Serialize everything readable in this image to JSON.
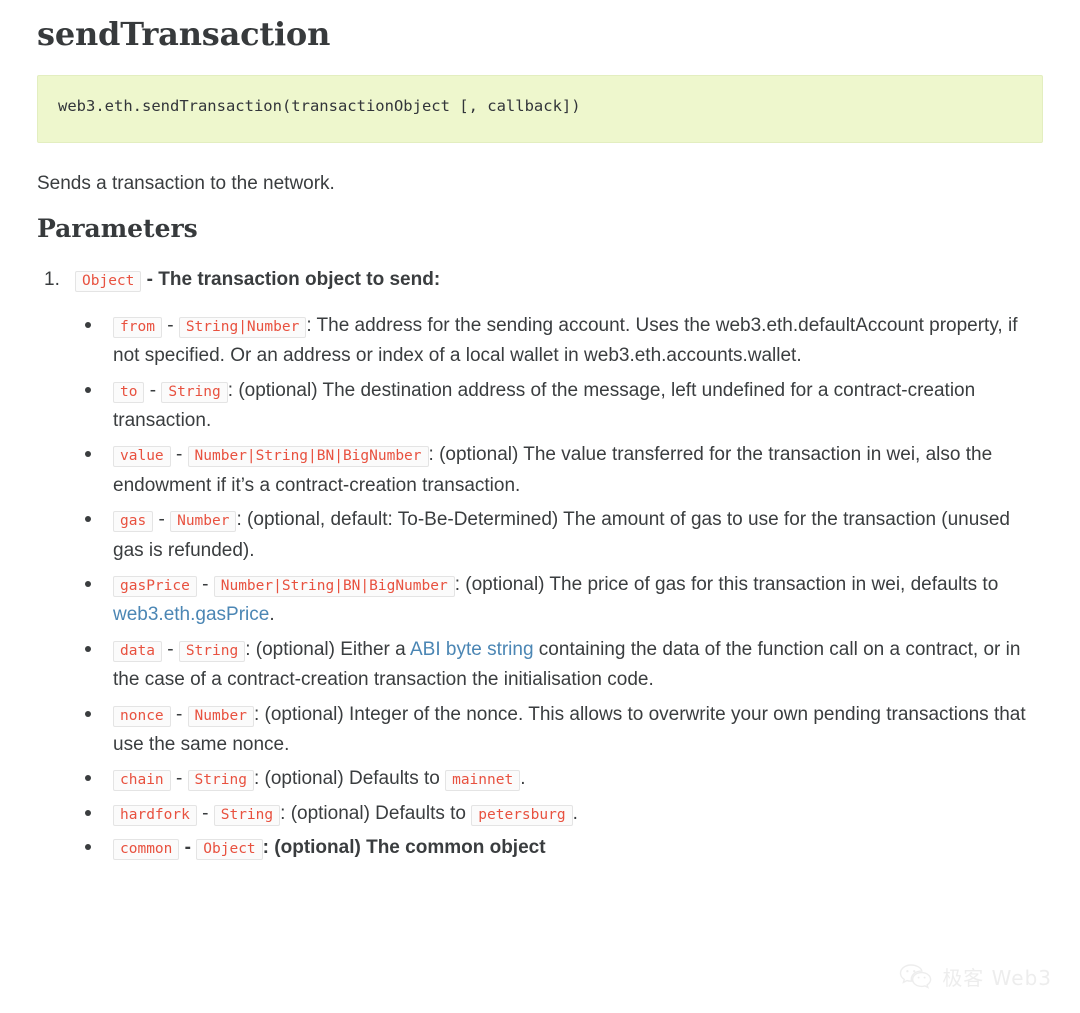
{
  "page": {
    "title": "sendTransaction",
    "signature": "web3.eth.sendTransaction(transactionObject [, callback])",
    "description": "Sends a transaction to the network.",
    "parameters_heading": "Parameters"
  },
  "colors": {
    "code_block_bg": "#eef7cd",
    "inline_code_text": "#e8513f",
    "inline_code_bg": "#fbfbfb",
    "inline_code_border": "#e4e4e4",
    "link": "#4b86b4",
    "body_text": "#3a3d3f",
    "heading_text": "#373a3c",
    "page_bg": "#ffffff"
  },
  "params": [
    {
      "marker": "1.",
      "type": "Object",
      "sep": "-",
      "text": "The transaction object to send:"
    }
  ],
  "sub_params": [
    {
      "name": "from",
      "sep": "-",
      "type": "String|Number",
      "colon": ":",
      "text_before_link": "The address for the sending account. Uses the web3.eth.defaultAccount property, if not specified. Or an address or index of a local wallet in web3.eth.accounts.wallet.",
      "bold": false
    },
    {
      "name": "to",
      "sep": "-",
      "type": "String",
      "colon": ":",
      "text_before_link": "(optional) The destination address of the message, left undefined for a contract-creation transaction.",
      "bold": false
    },
    {
      "name": "value",
      "sep": "-",
      "type": "Number|String|BN|BigNumber",
      "colon": ":",
      "text_before_link": "(optional) The value transferred for the transaction in wei, also the endowment if it’s a contract-creation transaction.",
      "bold": false
    },
    {
      "name": "gas",
      "sep": "-",
      "type": "Number",
      "colon": ":",
      "text_before_link": "(optional, default: To-Be-Determined) The amount of gas to use for the transaction (unused gas is refunded).",
      "bold": false
    },
    {
      "name": "gasPrice",
      "sep": "-",
      "type": "Number|String|BN|BigNumber",
      "colon": ":",
      "text_before_link": "(optional) The price of gas for this transaction in wei, defaults to ",
      "link_text": "web3.eth.gasPrice",
      "text_after_link": ".",
      "bold": false
    },
    {
      "name": "data",
      "sep": "-",
      "type": "String",
      "colon": ":",
      "text_before_link": "(optional) Either a ",
      "link_text": "ABI byte string",
      "text_after_link": " containing the data of the function call on a contract, or in the case of a contract-creation transaction the initialisation code.",
      "bold": false
    },
    {
      "name": "nonce",
      "sep": "-",
      "type": "Number",
      "colon": ":",
      "text_before_link": "(optional) Integer of the nonce. This allows to overwrite your own pending transactions that use the same nonce.",
      "bold": false
    },
    {
      "name": "chain",
      "sep": "-",
      "type": "String",
      "colon": ":",
      "text_before_link": "(optional) Defaults to ",
      "default_code": "mainnet",
      "text_after_link": ".",
      "bold": false
    },
    {
      "name": "hardfork",
      "sep": "-",
      "type": "String",
      "colon": ":",
      "text_before_link": "(optional) Defaults to ",
      "default_code": "petersburg",
      "text_after_link": ".",
      "bold": false
    },
    {
      "name": "common",
      "sep": "-",
      "type": "Object",
      "colon": ":",
      "text_before_link": "(optional) The common object",
      "bold": true
    }
  ],
  "watermark": {
    "text": "极客 Web3",
    "icon": "wechat-icon"
  }
}
